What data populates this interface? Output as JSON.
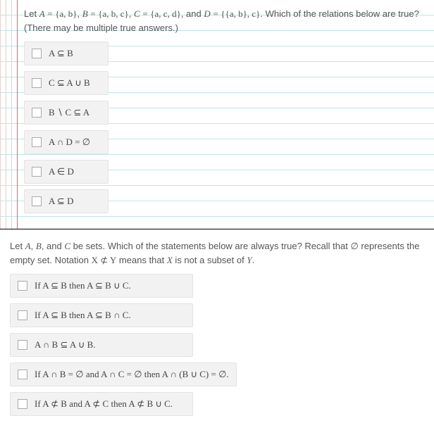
{
  "q1": {
    "A": "A",
    "B": "B",
    "C": "C",
    "D": "D",
    "eq": "=",
    "defA": "{a, b}",
    "defB": "{a, b, c}",
    "defC": "{a, c, d}",
    "defD": "{{a, b}, c}",
    "let": "Let ",
    "comma": ", ",
    "and": ", and ",
    "tail": ". Which of the relations below are true? (There may be multiple true answers.)",
    "opts": {
      "o1": "A ⊆ B",
      "o2": "C ⊆ A ∪ B",
      "o3": "B ∖ C ⊆ A",
      "o4": "A ∩ D = ∅",
      "o5": "A ∈ D",
      "o6": "A ⊆ D"
    }
  },
  "q2": {
    "p1a": "Let ",
    "A": "A",
    "B": "B",
    "C": "C",
    "comma": ", ",
    "and": ", and ",
    "p1b": " be sets. Which of the statements below are always true? Recall that ",
    "empty": "∅",
    "p2a": " represents the empty set. Notation ",
    "XnsubY": "X ⊄ Y",
    "p2b": " means that ",
    "X": "X",
    "p2c": " is not a subset of ",
    "Y": "Y",
    "p2d": ".",
    "opts": {
      "o1": "If A ⊆ B then A ⊆ B ∪ C.",
      "o2": "If A ⊆ B then A ⊆ B ∩ C.",
      "o3": "A ∩ B ⊆ A ∪ B.",
      "o4": "If A ∩ B = ∅ and A ∩ C = ∅ then A ∩ (B ∪ C) = ∅.",
      "o5": "If A ⊄ B and A ⊄ C then A ⊄ B ∪ C."
    }
  }
}
